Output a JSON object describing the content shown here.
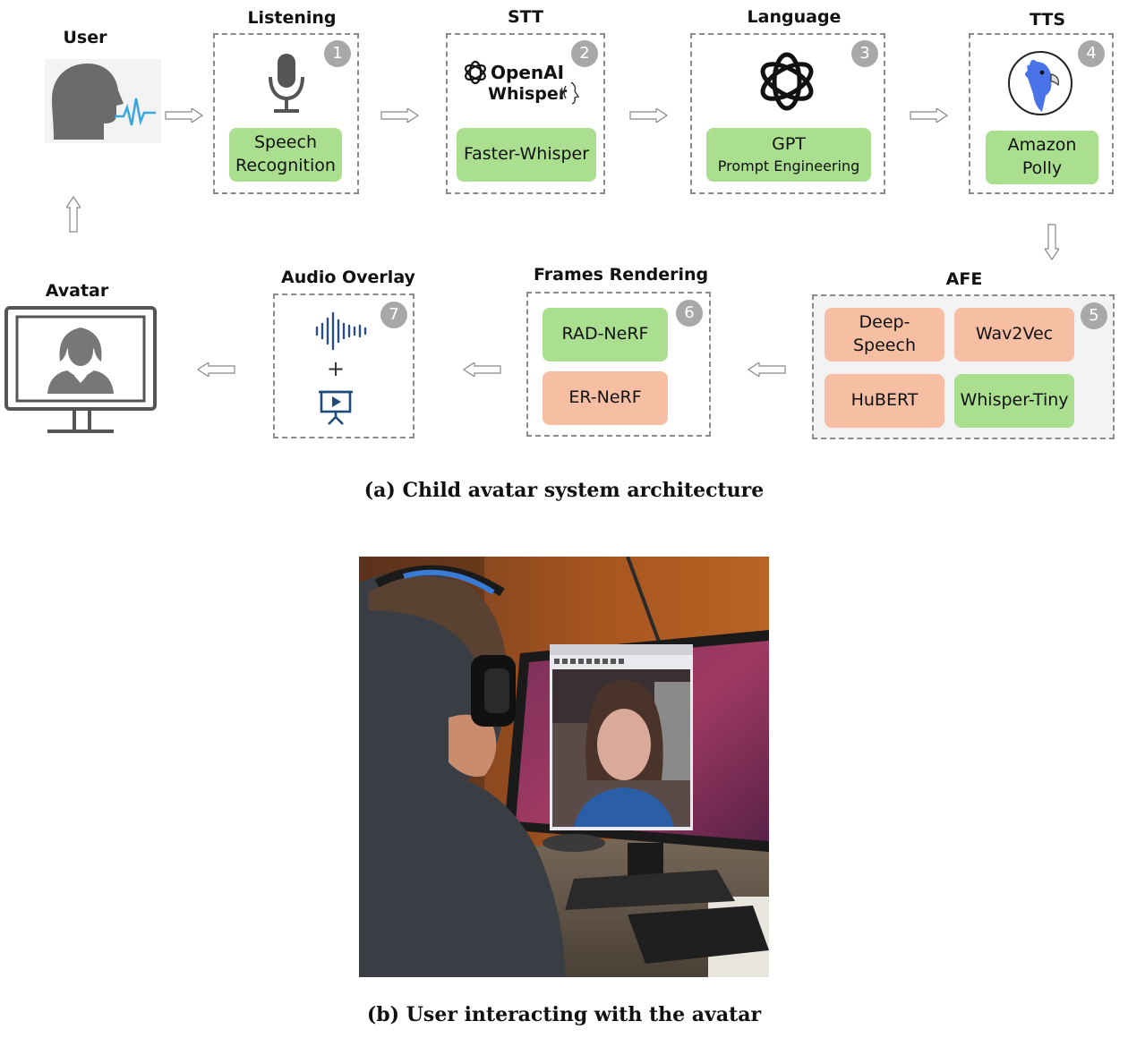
{
  "stages": {
    "user": "User",
    "listening": "Listening",
    "stt": "STT",
    "language": "Language",
    "tts": "TTS",
    "afe": "AFE",
    "frames": "Frames Rendering",
    "audio": "Audio Overlay",
    "avatar": "Avatar"
  },
  "badges": {
    "b1": "1",
    "b2": "2",
    "b3": "3",
    "b4": "4",
    "b5": "5",
    "b6": "6",
    "b7": "7"
  },
  "listening": {
    "line1": "Speech",
    "line2": "Recognition"
  },
  "stt": {
    "brand1": "OpenAI",
    "brand2": "Whisper",
    "model": "Faster-Whisper"
  },
  "language": {
    "line1": "GPT",
    "line2": "Prompt Engineering"
  },
  "tts": {
    "model": "Amazon Polly"
  },
  "afe": {
    "m1": "Deep-Speech",
    "m2": "Wav2Vec",
    "m3": "HuBERT",
    "m4": "Whisper-Tiny"
  },
  "frames": {
    "m1": "RAD-NeRF",
    "m2": "ER-NeRF"
  },
  "audio": {
    "plus": "+"
  },
  "captions": {
    "a": "(a) Child avatar system architecture",
    "b": "(b) User interacting with the avatar"
  },
  "colors": {
    "green": "#a9df8f",
    "salmon": "#f6bea3",
    "border": "#8a8a8a",
    "badge": "#a8a8a8"
  }
}
